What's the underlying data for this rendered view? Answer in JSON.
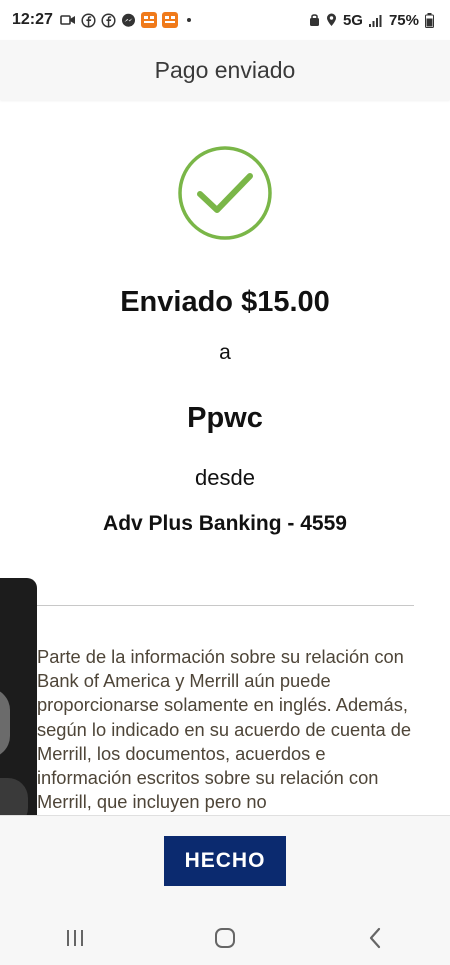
{
  "status_bar": {
    "time": "12:27",
    "network": "5G",
    "battery": "75%",
    "icons": [
      "video-call-icon",
      "facebook-icon",
      "facebook-icon",
      "messenger-icon",
      "app-badge-icon",
      "app-badge-icon"
    ]
  },
  "header": {
    "title": "Pago enviado"
  },
  "confirmation": {
    "icon": "check-circle-icon",
    "sent_amount": "Enviado $15.00",
    "connector_a": "a",
    "recipient": "Ppwc",
    "connector_from": "desde",
    "account": "Adv Plus Banking - 4559"
  },
  "disclaimer": {
    "text": "Parte de la información sobre su relación con Bank of America y Merrill aún puede proporcionarse solamente en inglés. Además, según lo indicado en su acuerdo de cuenta de Merrill, los documentos, acuerdos e información escritos sobre su relación con Merrill, que incluyen pero no"
  },
  "footer": {
    "done_label": "HECHO"
  },
  "colors": {
    "check_green": "#7ab648",
    "button_navy": "#0b2a6f",
    "disclaimer_text": "#4e4538"
  }
}
